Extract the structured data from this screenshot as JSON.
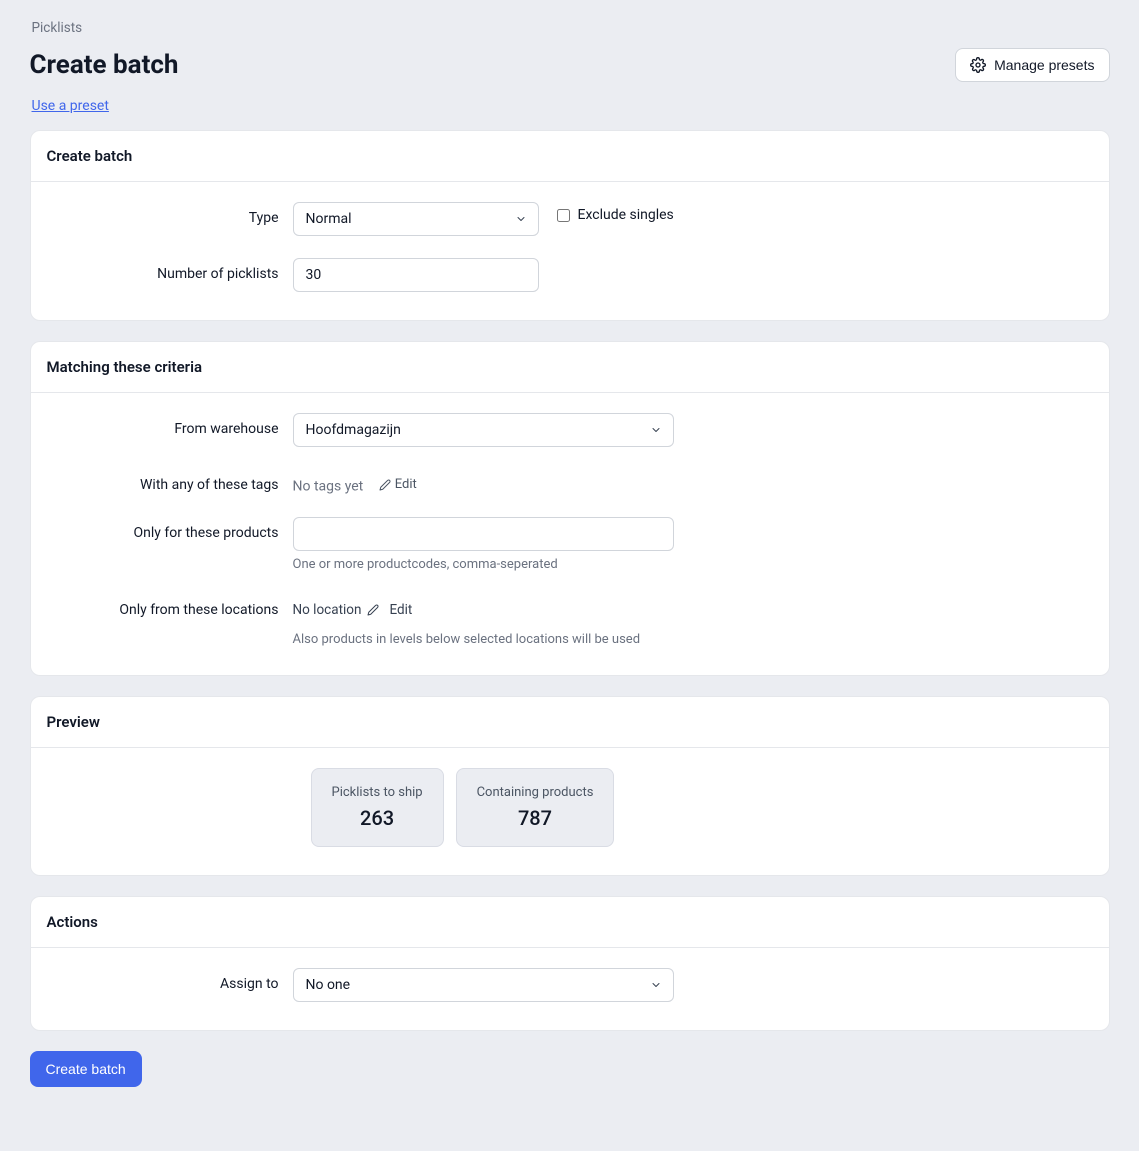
{
  "breadcrumb": "Picklists",
  "page_title": "Create batch",
  "manage_presets_label": "Manage presets",
  "use_preset_link": "Use a preset",
  "cards": {
    "create_batch": {
      "title": "Create batch",
      "type_label": "Type",
      "type_value": "Normal",
      "exclude_singles_label": "Exclude singles",
      "num_picklists_label": "Number of picklists",
      "num_picklists_value": "30"
    },
    "criteria": {
      "title": "Matching these criteria",
      "warehouse_label": "From warehouse",
      "warehouse_value": "Hoofdmagazijn",
      "tags_label": "With any of these tags",
      "tags_value": "No tags yet",
      "tags_edit": "Edit",
      "products_label": "Only for these products",
      "products_help": "One or more productcodes, comma-seperated",
      "locations_label": "Only from these locations",
      "locations_value": "No location",
      "locations_edit": "Edit",
      "locations_help": "Also products in levels below selected locations will be used"
    },
    "preview": {
      "title": "Preview",
      "picklists_label": "Picklists to ship",
      "picklists_value": "263",
      "products_label": "Containing products",
      "products_value": "787"
    },
    "actions": {
      "title": "Actions",
      "assign_label": "Assign to",
      "assign_value": "No one"
    }
  },
  "submit_label": "Create batch"
}
